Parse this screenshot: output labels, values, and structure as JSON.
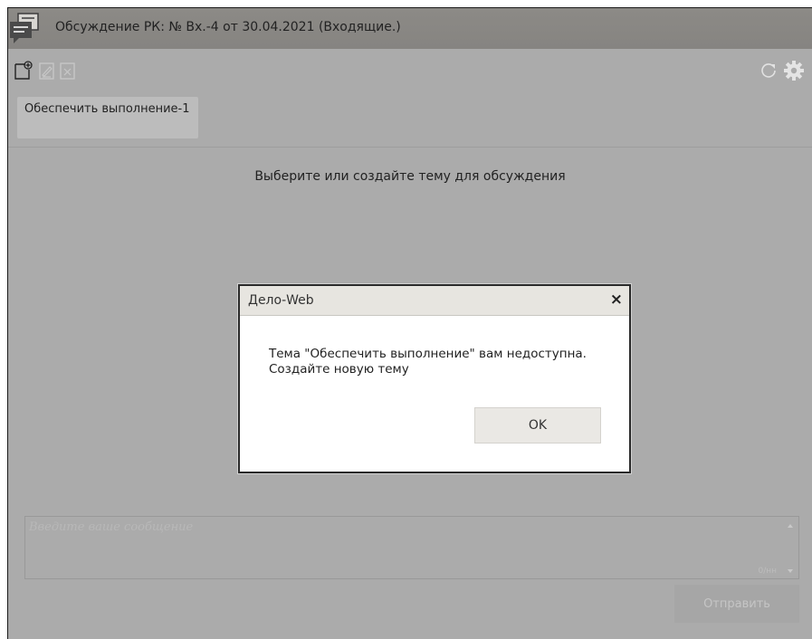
{
  "window": {
    "title": "Обсуждение РК: № Вх.-4 от 30.04.2021 (Входящие.)",
    "icons": [
      "chat-app-icon"
    ]
  },
  "toolbar": {
    "left_icons": [
      "add-topic-icon",
      "edit-topic-icon",
      "delete-topic-icon"
    ],
    "right_icons": [
      "refresh-icon",
      "settings-gear-icon"
    ]
  },
  "topics": [
    {
      "label": "Обеспечить выполнение-1"
    }
  ],
  "main": {
    "hint": "Выберите или создайте тему для обсуждения"
  },
  "composer": {
    "placeholder": "Введите ваше сообщение",
    "counter": "0/нн",
    "send_label": "Отправить"
  },
  "dialog": {
    "title": "Дело-Web",
    "close_symbol": "×",
    "message_line1": "Тема \"Обеспечить выполнение\" вам недоступна.",
    "message_line2": "Создайте новую тему",
    "ok_label": "OK"
  },
  "colors": {
    "overlay_gray": "#ababab",
    "titlebar": "#878582",
    "dialog_header": "#e7e5e0"
  }
}
